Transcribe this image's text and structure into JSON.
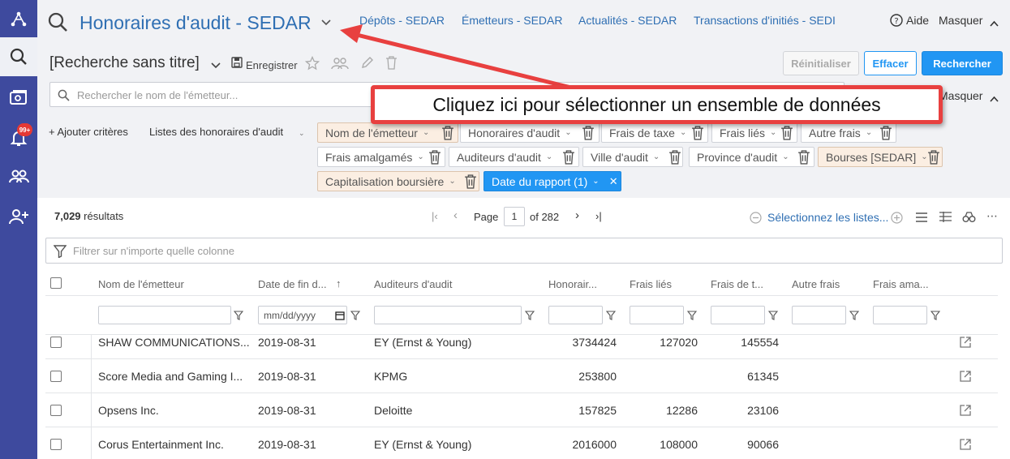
{
  "app": {
    "title": "Honoraires d'audit - SEDAR",
    "nav": [
      "Dépôts - SEDAR",
      "Émetteurs - SEDAR",
      "Actualités - SEDAR",
      "Transactions d'initiés - SEDI"
    ],
    "help": "Aide",
    "hide": "Masquer",
    "hide2": "Masquer"
  },
  "search": {
    "name": "[Recherche sans titre]",
    "save": "Enregistrer",
    "issuer_placeholder": "Rechercher le nom de l'émetteur...",
    "reset": "Réinitialiser",
    "clear": "Effacer",
    "search": "Rechercher"
  },
  "callout": "Cliquez ici pour sélectionner un ensemble de données",
  "criteria": {
    "add": "+ Ajouter critères",
    "lists": "Listes des honoraires d'audit",
    "chips": [
      "Nom de l'émetteur",
      "Honoraires d'audit",
      "Frais de taxe",
      "Frais liés",
      "Autre frais",
      "Frais amalgamés",
      "Auditeurs d'audit",
      "Ville d'audit",
      "Province d'audit",
      "Bourses [SEDAR]",
      "Capitalisation boursière",
      "Date du rapport (1)"
    ]
  },
  "results": {
    "count": "7,029",
    "label": "résultats",
    "page_label": "Page",
    "page": "1",
    "of": "of 282",
    "select_lists": "Sélectionnez les listes...",
    "filter_placeholder": "Filtrer sur n'importe quelle colonne"
  },
  "table": {
    "headers": [
      "Nom de l'émetteur",
      "Date de fin d...",
      "Auditeurs d'audit",
      "Honorair...",
      "Frais liés",
      "Frais de t...",
      "Autre frais",
      "Frais ama..."
    ],
    "date_placeholder": "mm/dd/yyyy",
    "rows": [
      {
        "name": "SHAW COMMUNICATIONS...",
        "date": "2019-08-31",
        "auditor": "EY (Ernst & Young)",
        "fees": "3734424",
        "related": "127020",
        "tax": "145554"
      },
      {
        "name": "Score Media and Gaming I...",
        "date": "2019-08-31",
        "auditor": "KPMG",
        "fees": "253800",
        "related": "",
        "tax": "61345"
      },
      {
        "name": "Opsens Inc.",
        "date": "2019-08-31",
        "auditor": "Deloitte",
        "fees": "157825",
        "related": "12286",
        "tax": "23106"
      },
      {
        "name": "Corus Entertainment Inc.",
        "date": "2019-08-31",
        "auditor": "EY (Ernst & Young)",
        "fees": "2016000",
        "related": "108000",
        "tax": "90066"
      }
    ]
  },
  "rail": {
    "badge": "99+"
  },
  "colors": {
    "brand": "#2f6fb3",
    "rail": "#3e4a9e",
    "primary_button": "#2196f3",
    "callout_border": "#e8403f"
  }
}
